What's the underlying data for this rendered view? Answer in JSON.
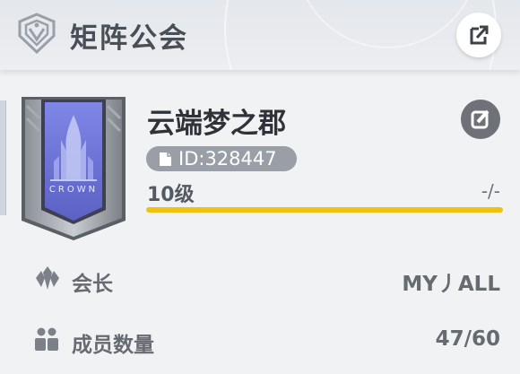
{
  "header": {
    "title": "矩阵公会",
    "logo_icon": "guild-emblem-icon",
    "share_icon": "share-icon"
  },
  "guild": {
    "name": "云端梦之郡",
    "id_text": "ID:328447",
    "level_label": "10级",
    "exp_text": "-/-",
    "exp_progress": 1.0,
    "banner_text": "CROWN",
    "edit_icon": "edit-icon"
  },
  "info_rows": [
    {
      "label": "会长",
      "value": "MY丿ALL",
      "icon": "leader-icon"
    },
    {
      "label": "成员数量",
      "value": "47/60",
      "icon": "members-icon"
    }
  ],
  "colors": {
    "accent_bar": "#f0c20b",
    "badge_bg": "#9a9ea6",
    "banner_purple": "#6f76d8",
    "text_dark": "#2f3238"
  }
}
